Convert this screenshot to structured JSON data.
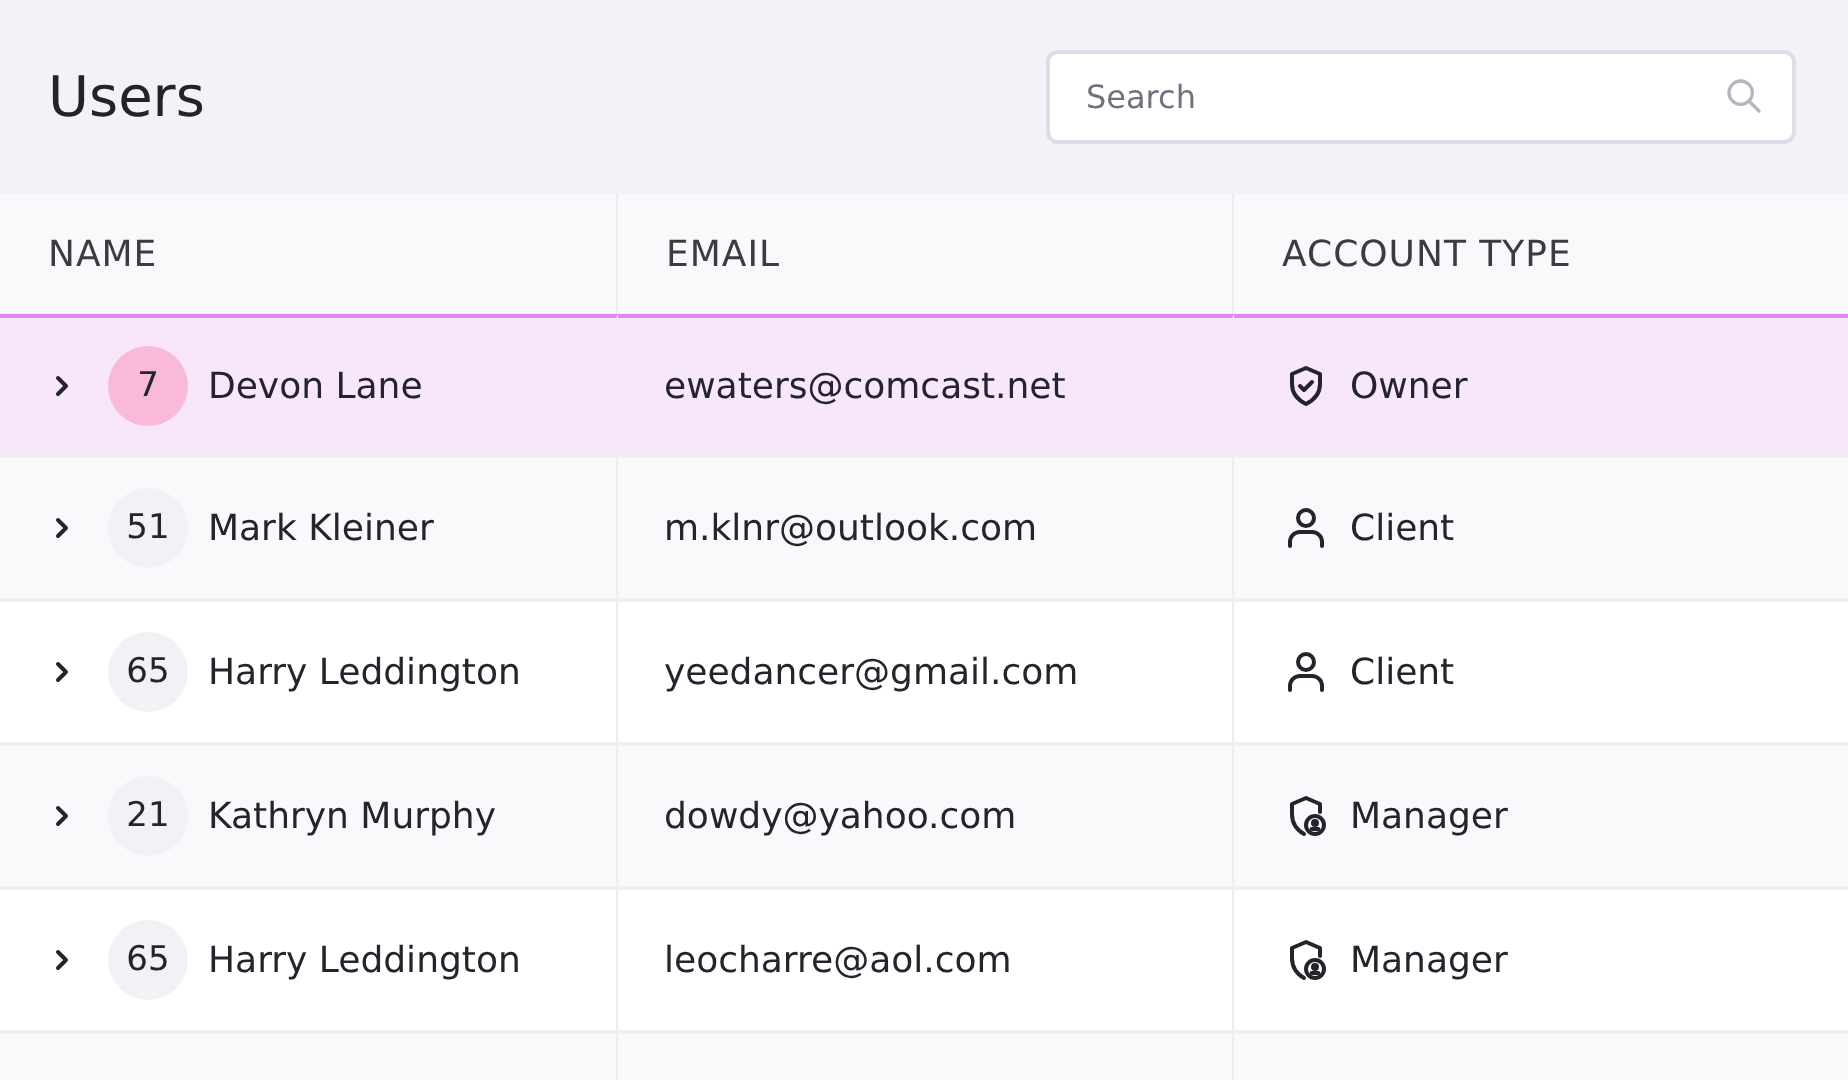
{
  "title": "Users",
  "search": {
    "placeholder": "Search"
  },
  "table": {
    "columns": [
      "NAME",
      "EMAIL",
      "ACCOUNT TYPE"
    ],
    "rows": [
      {
        "selected": true,
        "expanded": false,
        "badge": "7",
        "name": "Devon Lane",
        "email": "ewaters@comcast.net",
        "account_type": {
          "kind": "owner",
          "label": "Owner"
        }
      },
      {
        "selected": false,
        "expanded": false,
        "badge": "51",
        "name": "Mark Kleiner",
        "email": "m.klnr@outlook.com",
        "account_type": {
          "kind": "client",
          "label": "Client"
        }
      },
      {
        "selected": false,
        "expanded": false,
        "badge": "65",
        "name": "Harry Leddington",
        "email": "yeedancer@gmail.com",
        "account_type": {
          "kind": "client",
          "label": "Client"
        }
      },
      {
        "selected": false,
        "expanded": false,
        "badge": "21",
        "name": "Kathryn Murphy",
        "email": "dowdy@yahoo.com",
        "account_type": {
          "kind": "manager",
          "label": "Manager"
        }
      },
      {
        "selected": false,
        "expanded": false,
        "badge": "65",
        "name": "Harry Leddington",
        "email": "leocharre@aol.com",
        "account_type": {
          "kind": "manager",
          "label": "Manager"
        }
      }
    ]
  }
}
